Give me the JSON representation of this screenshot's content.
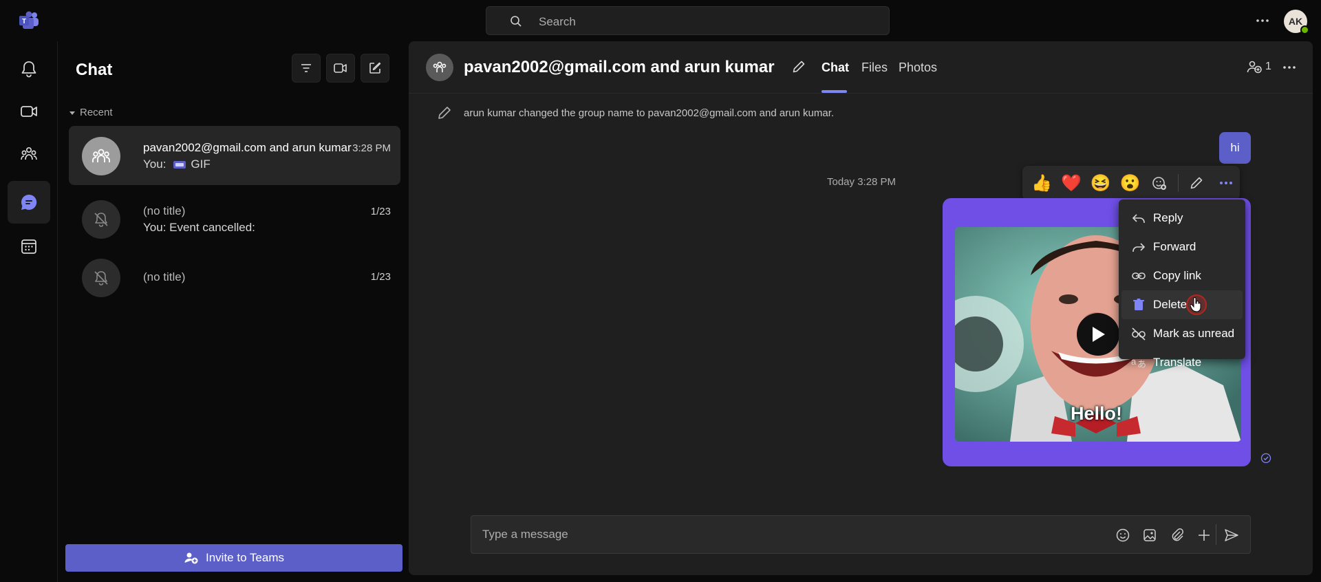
{
  "search": {
    "placeholder": "Search"
  },
  "user": {
    "initials": "AK"
  },
  "list": {
    "title": "Chat",
    "section": "Recent",
    "items": [
      {
        "name": "pavan2002@gmail.com and arun kumar",
        "preview_prefix": "You:",
        "preview": "GIF",
        "time": "3:28 PM"
      },
      {
        "name": "(no title)",
        "preview": "You: Event cancelled:",
        "time": "1/23"
      },
      {
        "name": "(no title)",
        "preview": "",
        "time": "1/23"
      }
    ],
    "invite_label": "Invite to Teams"
  },
  "conversation": {
    "title": "pavan2002@gmail.com and arun kumar",
    "tabs": [
      "Chat",
      "Files",
      "Photos"
    ],
    "participants_count": "1",
    "system_message": "arun kumar changed the group name to pavan2002@gmail.com and arun kumar.",
    "sent_message": "hi",
    "timestamp": "Today 3:28 PM",
    "gif_caption": "Hello!"
  },
  "reactions": [
    "👍",
    "❤️",
    "😆",
    "😮"
  ],
  "context_menu": {
    "items": [
      {
        "label": "Reply",
        "icon": "reply-icon"
      },
      {
        "label": "Forward",
        "icon": "forward-icon"
      },
      {
        "label": "Copy link",
        "icon": "link-icon"
      },
      {
        "label": "Delete",
        "icon": "trash-icon"
      },
      {
        "label": "Mark as unread",
        "icon": "mark-unread-icon"
      },
      {
        "label": "Translate",
        "icon": "translate-icon"
      }
    ]
  },
  "composer": {
    "placeholder": "Type a message"
  },
  "colors": {
    "accent": "#5b5fc7",
    "accent_light": "#7f85f5",
    "background": "#0a0a0a",
    "panel": "#1f1f1f"
  }
}
